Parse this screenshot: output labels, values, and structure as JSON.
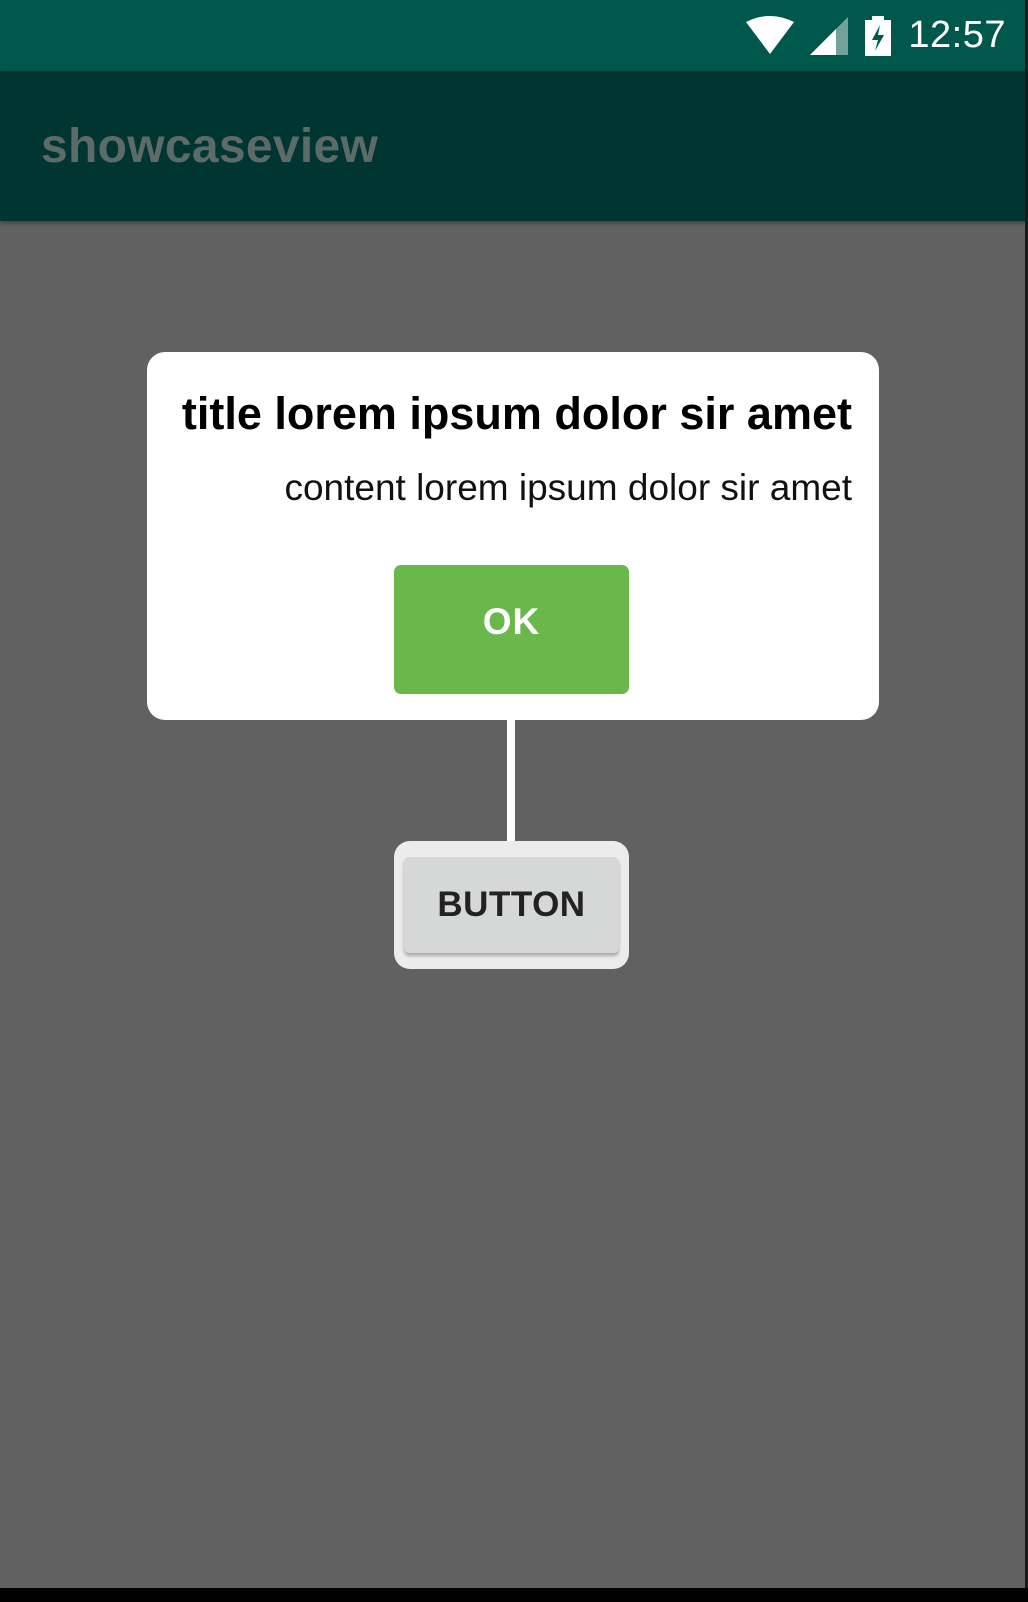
{
  "status_bar": {
    "time": "12:57",
    "icons": [
      "wifi-icon",
      "cellular-signal-icon",
      "battery-charging-icon"
    ]
  },
  "app_bar": {
    "title": "showcaseview"
  },
  "showcase": {
    "title": "title lorem ipsum dolor sir amet",
    "content": "content lorem ipsum dolor sir amet",
    "ok_label": "OK"
  },
  "target": {
    "button_label": "BUTTON"
  },
  "colors": {
    "status_bar": "#00574b",
    "app_bar": "#003531",
    "overlay": "#616161",
    "ok_button": "#6ab84c",
    "tooltip_bg": "#ffffff"
  }
}
